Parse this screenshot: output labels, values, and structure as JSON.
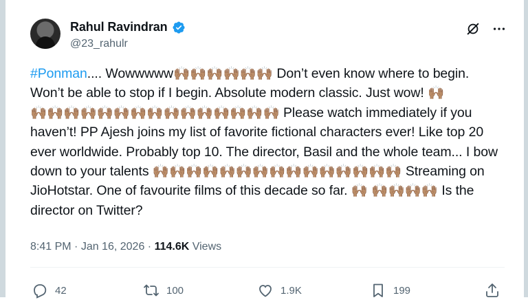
{
  "author": {
    "name": "Rahul Ravindran",
    "handle": "@23_rahulr"
  },
  "tweet": {
    "hashtag": "#Ponman",
    "segments": [
      "....  Wowwwww",
      "clap6",
      "  Don’t even know where to begin. Won’t be able to stop if I begin. Absolute modern classic. Just wow! ",
      "clap1",
      "clap15",
      " Please watch immediately if you haven’t! PP Ajesh joins my list of favorite fictional characters ever! Like top 20 ever worldwide. Probably top 10. The director, Basil and the whole team... I bow down to your talents ",
      "clap15",
      " Streaming on JioHotstar. One of favourite films of this decade so far. ",
      "clap1",
      "clap4",
      " Is the director on Twitter?"
    ]
  },
  "meta": {
    "time": "8:41 PM",
    "date": "Jan 16, 2026",
    "views_count": "114.6K",
    "views_label": "Views",
    "separator": " · "
  },
  "actions": {
    "replies": "42",
    "reposts": "100",
    "likes": "1.9K",
    "bookmarks": "199"
  },
  "icons": {
    "clap_emoji": "🙌🏽",
    "accent": "#1d9bf0",
    "muted": "#536471"
  }
}
